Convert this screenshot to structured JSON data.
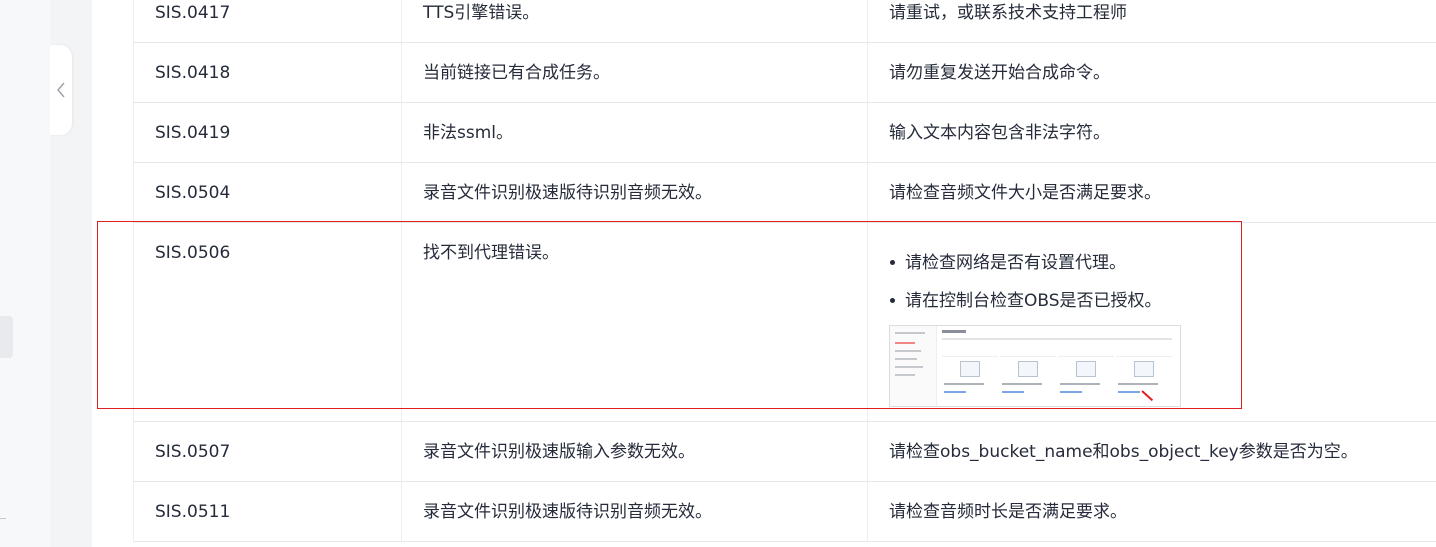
{
  "page": {
    "highlight_color": "#e02020",
    "sidebar_toggle_icon": "chevron-left-icon"
  },
  "table": {
    "rows": [
      {
        "code": "SIS.0417",
        "description": "TTS引擎错误。",
        "solution": "请重试，或联系技术支持工程师"
      },
      {
        "code": "SIS.0418",
        "description": "当前链接已有合成任务。",
        "solution": "请勿重复发送开始合成命令。"
      },
      {
        "code": "SIS.0419",
        "description": "非法ssml。",
        "solution": "输入文本内容包含非法字符。"
      },
      {
        "code": "SIS.0504",
        "description": "录音文件识别极速版待识别音频无效。",
        "solution": "请检查音频文件大小是否满足要求。"
      },
      {
        "code": "SIS.0506",
        "description": "找不到代理错误。",
        "solution_items": [
          "请检查网络是否有设置代理。",
          "请在控制台检查OBS是否已授权。"
        ],
        "screenshot": "console-screenshot-thumbnail"
      },
      {
        "code": "SIS.0507",
        "description": "录音文件识别极速版输入参数无效。",
        "solution": "请检查obs_bucket_name和obs_object_key参数是否为空。"
      },
      {
        "code": "SIS.0511",
        "description": "录音文件识别极速版待识别音频无效。",
        "solution": "请检查音频时长是否满足要求。"
      }
    ]
  }
}
